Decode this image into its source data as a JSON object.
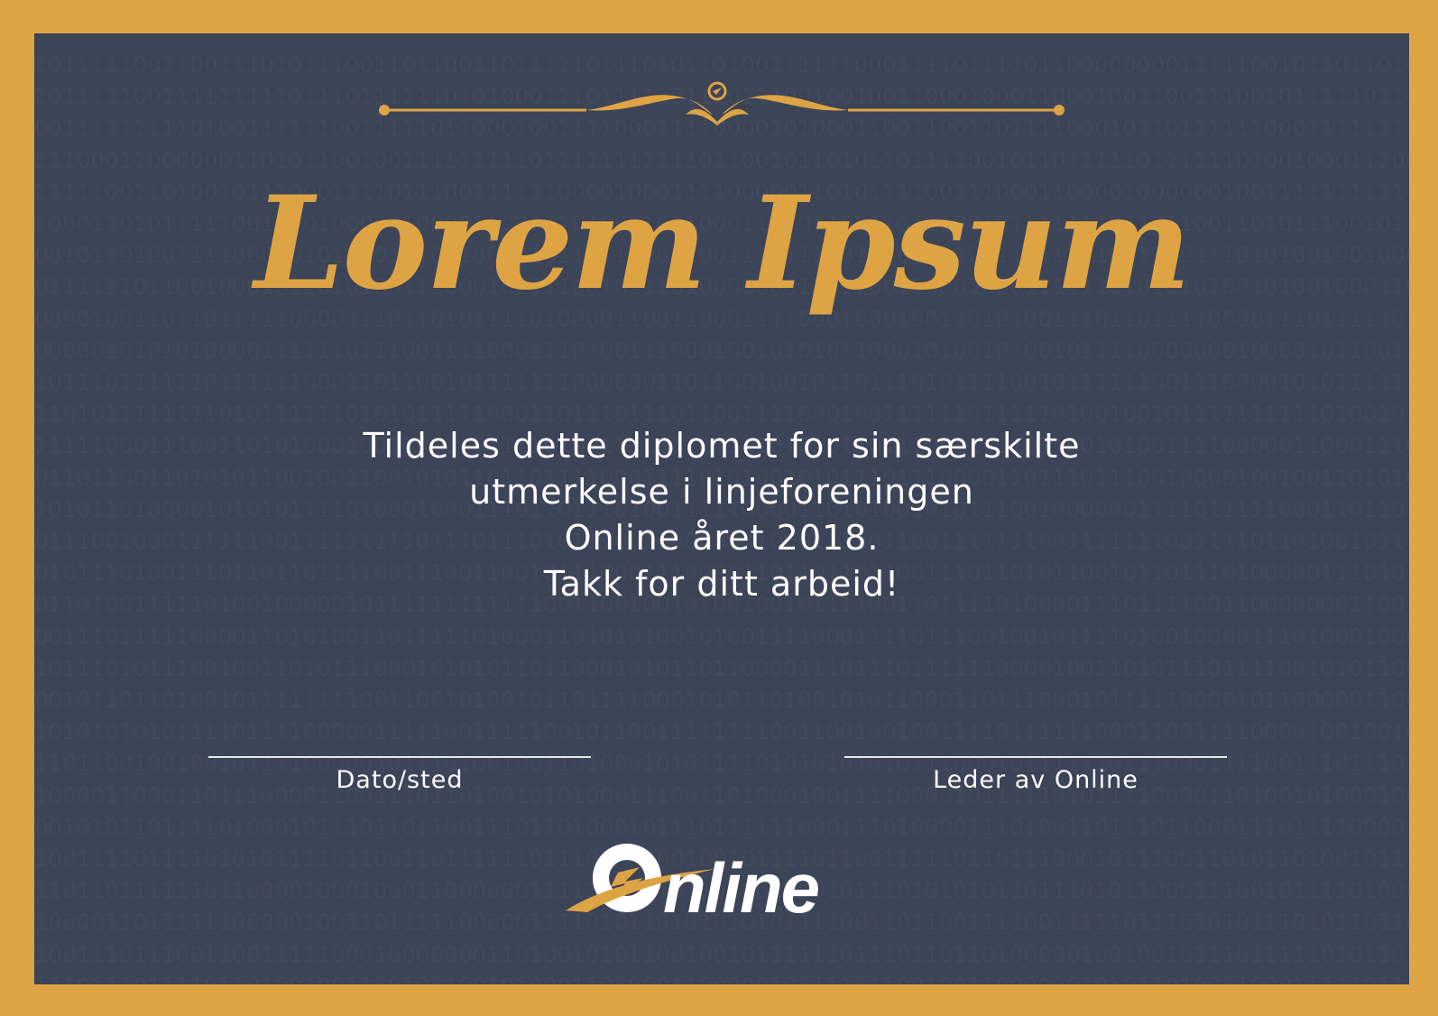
{
  "diploma": {
    "title": "Lorem Ipsum",
    "body_lines": [
      "Tildeles dette diplomet for sin særskilte",
      "utmerkelse i linjeforeningen",
      "Online året 2018.",
      "Takk for ditt arbeid!"
    ],
    "signature_left_label": "Dato/sted",
    "signature_right_label": "Leder av Online",
    "logo_text": "Online"
  },
  "colors": {
    "border": "#dea444",
    "background": "#3c4458",
    "accent": "#dea444",
    "text": "#ffffff"
  },
  "icons": {
    "ornament": "flourish-divider-icon",
    "logo": "online-logo"
  }
}
